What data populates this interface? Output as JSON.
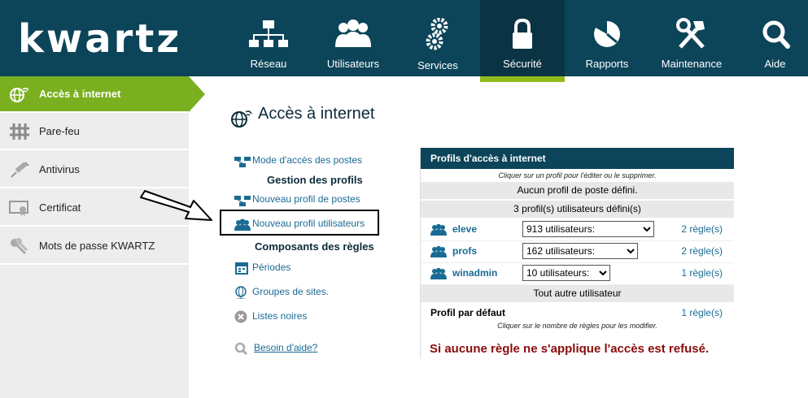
{
  "logo": "kwartz",
  "nav": [
    {
      "label": "Réseau",
      "icon": "network-icon"
    },
    {
      "label": "Utilisateurs",
      "icon": "users-icon"
    },
    {
      "label": "Services",
      "icon": "gears-icon"
    },
    {
      "label": "Sécurité",
      "icon": "lock-icon",
      "active": true
    },
    {
      "label": "Rapports",
      "icon": "pie-chart-icon"
    },
    {
      "label": "Maintenance",
      "icon": "tools-icon"
    },
    {
      "label": "Aide",
      "icon": "magnifier-icon"
    }
  ],
  "sidebar": [
    {
      "label": "Accès à internet",
      "icon": "globe-icon",
      "active": true
    },
    {
      "label": "Pare-feu",
      "icon": "firewall-icon"
    },
    {
      "label": "Antivirus",
      "icon": "syringe-icon"
    },
    {
      "label": "Certificat",
      "icon": "certificate-icon"
    },
    {
      "label": "Mots de passe KWARTZ",
      "icon": "keys-icon"
    }
  ],
  "main": {
    "title": "Accès à internet",
    "links": {
      "mode_acces": "Mode d'accès des postes",
      "gestion_profils": "Gestion des profils",
      "nouveau_profil_postes": "Nouveau profil de postes",
      "nouveau_profil_utilisateurs": "Nouveau profil utilisateurs",
      "composants_regles": "Composants des règles",
      "periodes": "Périodes",
      "groupes_sites": "Groupes de sites.",
      "listes_noires": "Listes noires",
      "besoin_aide": "Besoin d'aide?"
    }
  },
  "panel": {
    "header": "Profils d'accès à internet",
    "hint_top": "Cliquer sur un profil pour l'éditer ou le supprimer.",
    "no_poste_profile": "Aucun profil de poste défini.",
    "user_profile_count": "3 profil(s) utilisateurs défini(s)",
    "profiles": [
      {
        "name": "eleve",
        "select": "913 utilisateurs:",
        "rules": "2 règle(s)"
      },
      {
        "name": "profs",
        "select": "162 utilisateurs:",
        "rules": "2 règle(s)"
      },
      {
        "name": "winadmin",
        "select": "10 utilisateurs:",
        "rules": "1 règle(s)"
      }
    ],
    "other_users": "Tout autre utilisateur",
    "default_profile": "Profil par défaut",
    "default_rules": "1 règle(s)",
    "hint_bottom": "Cliquer sur le nombre de règles pour les modifier.",
    "refused_msg": "Si aucune règle ne s'applique l'accès est refusé."
  },
  "colors": {
    "nav_bg": "#0c4459",
    "accent": "#7ab020",
    "link": "#1a6b94",
    "error": "#8b0a0a"
  }
}
